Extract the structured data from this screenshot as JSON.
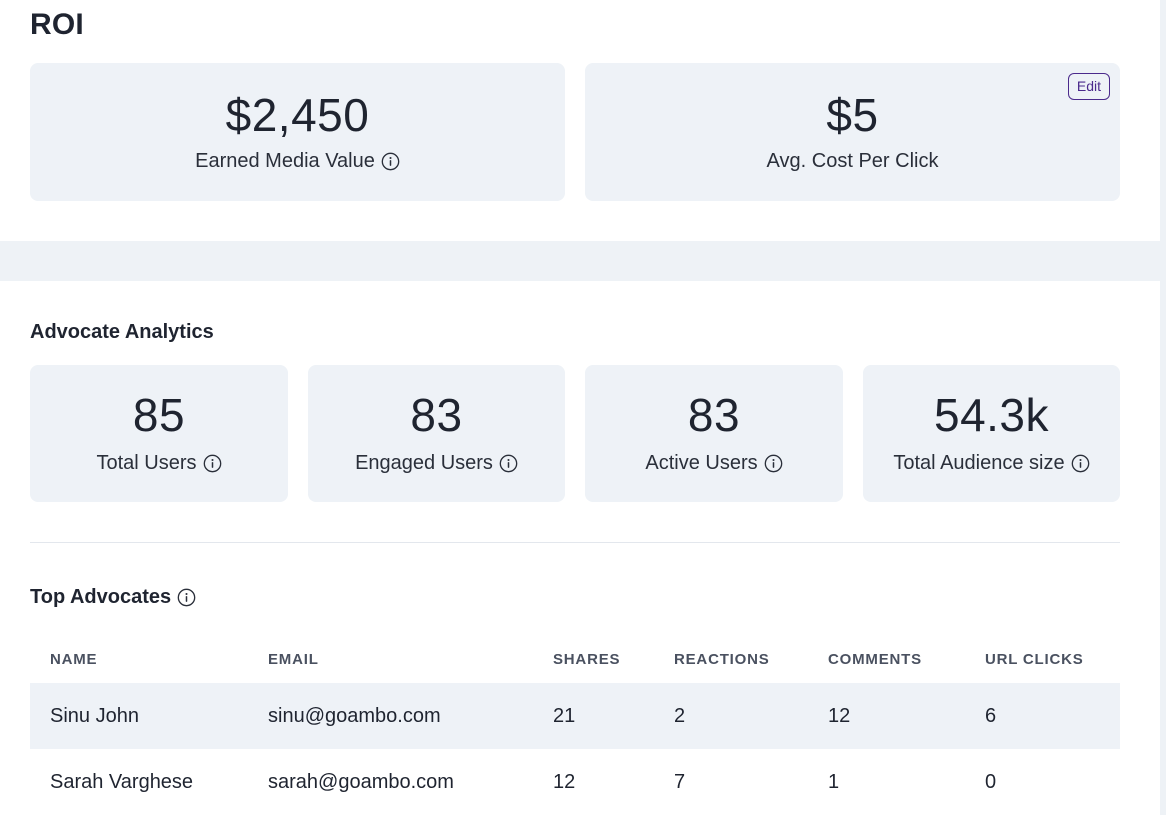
{
  "roi": {
    "title": "ROI",
    "cards": [
      {
        "value": "$2,450",
        "label": "Earned Media Value",
        "has_info": true
      },
      {
        "value": "$5",
        "label": "Avg. Cost Per Click",
        "has_info": false,
        "action_label": "Edit"
      }
    ]
  },
  "advocate_analytics": {
    "title": "Advocate Analytics",
    "stats": [
      {
        "value": "85",
        "label": "Total Users"
      },
      {
        "value": "83",
        "label": "Engaged Users"
      },
      {
        "value": "83",
        "label": "Active Users"
      },
      {
        "value": "54.3k",
        "label": "Total Audience size"
      }
    ]
  },
  "top_advocates": {
    "title": "Top Advocates",
    "columns": [
      "NAME",
      "EMAIL",
      "SHARES",
      "REACTIONS",
      "COMMENTS",
      "URL CLICKS"
    ],
    "rows": [
      [
        "Sinu John",
        "sinu@goambo.com",
        "21",
        "2",
        "12",
        "6"
      ],
      [
        "Sarah Varghese",
        "sarah@goambo.com",
        "12",
        "7",
        "1",
        "0"
      ]
    ]
  },
  "icons": {
    "info": "info-circle-icon"
  },
  "colors": {
    "card_bg": "#eef2f7",
    "accent": "#4b2a8c",
    "text": "#1f2430"
  }
}
